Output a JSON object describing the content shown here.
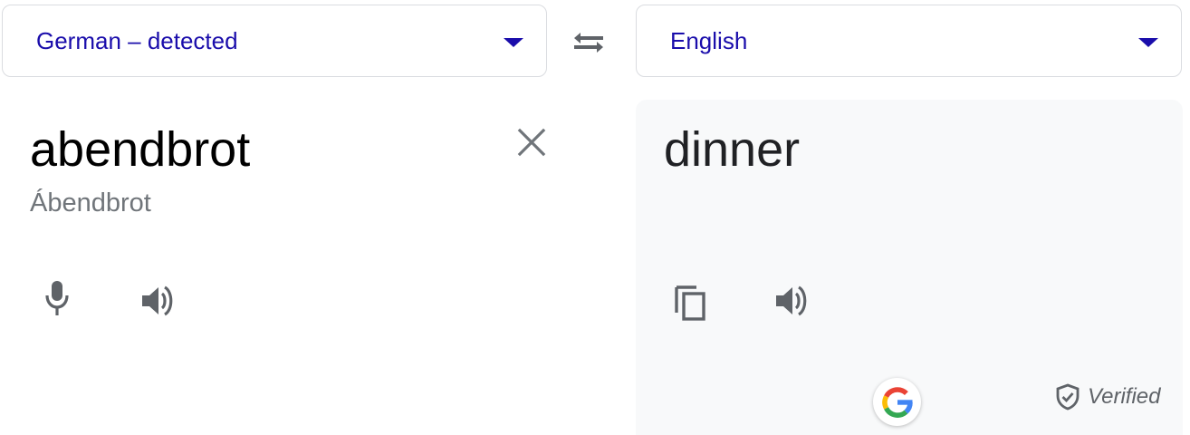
{
  "source_language": {
    "label": "German – detected",
    "dropdown_icon": "caret-down-icon"
  },
  "target_language": {
    "label": "English",
    "dropdown_icon": "caret-down-icon"
  },
  "swap_icon": "swap-arrows-icon",
  "source": {
    "text": "abendbrot",
    "transliteration": "Ábendbrot",
    "clear_icon": "close-icon",
    "mic_icon": "microphone-icon",
    "speaker_icon": "speaker-icon"
  },
  "target": {
    "text": "dinner",
    "copy_icon": "copy-icon",
    "speaker_icon": "speaker-icon",
    "google_icon": "google-g-icon",
    "verified_icon": "shield-check-icon",
    "verified_label": "Verified"
  },
  "colors": {
    "link_blue": "#1a0dab",
    "icon_gray": "#5f6368",
    "translation_bg": "#f8f9fa",
    "border": "#dadce0"
  }
}
